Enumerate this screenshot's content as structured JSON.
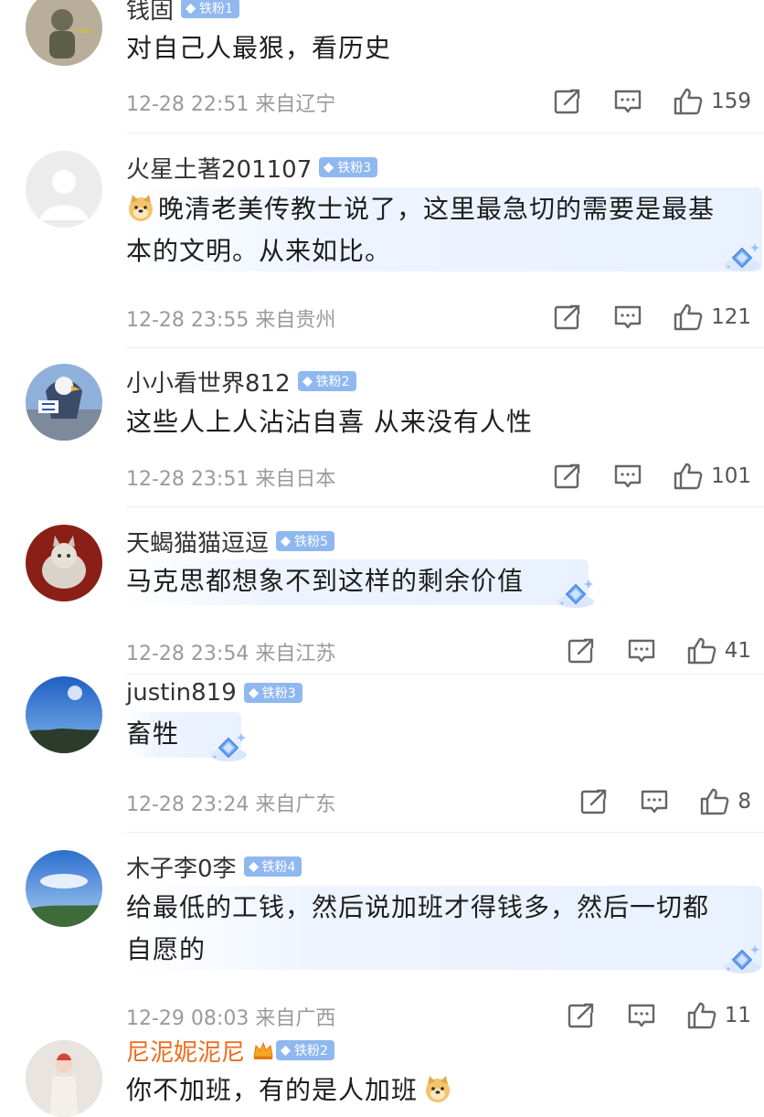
{
  "comments": [
    {
      "username": "钱固",
      "badge": "铁粉1",
      "text": "对自己人最狠，看历史",
      "time": "12-28 22:51",
      "location": "来自辽宁",
      "likes": "159"
    },
    {
      "username": "火星土著201107",
      "badge": "铁粉3",
      "text_line1": "晚清老美传教士说了，这里最急切的需要是最基",
      "text_line2": "本的文明。从来如比。",
      "time": "12-28 23:55",
      "location": "来自贵州",
      "likes": "121"
    },
    {
      "username": "小小看世界812",
      "badge": "铁粉2",
      "text": "这些人上人沾沾自喜  从来没有人性",
      "time": "12-28 23:51",
      "location": "来自日本",
      "likes": "101"
    },
    {
      "username": "天蝎猫猫逗逗",
      "badge": "铁粉5",
      "text": "马克思都想象不到这样的剩余价值",
      "time": "12-28 23:54",
      "location": "来自江苏",
      "likes": "41"
    },
    {
      "username": "justin819",
      "badge": "铁粉3",
      "text": "畜牲",
      "time": "12-28 23:24",
      "location": "来自广东",
      "likes": "8"
    },
    {
      "username": "木子李0李",
      "badge": "铁粉4",
      "text_line1": "给最低的工钱，然后说加班才得钱多，然后一切都",
      "text_line2": "自愿的",
      "time": "12-29 08:03",
      "location": "来自广西",
      "likes": "11"
    },
    {
      "username": "尼泥妮泥尼",
      "badge": "铁粉2",
      "text": "你不加班，有的是人加班"
    }
  ],
  "icons": {
    "share": "share-icon",
    "comment": "comment-icon",
    "like": "thumbs-up-icon"
  },
  "colors": {
    "badge": "#8fb8f0",
    "vip_name": "#f26a1b",
    "meta": "#9a9a9a"
  }
}
